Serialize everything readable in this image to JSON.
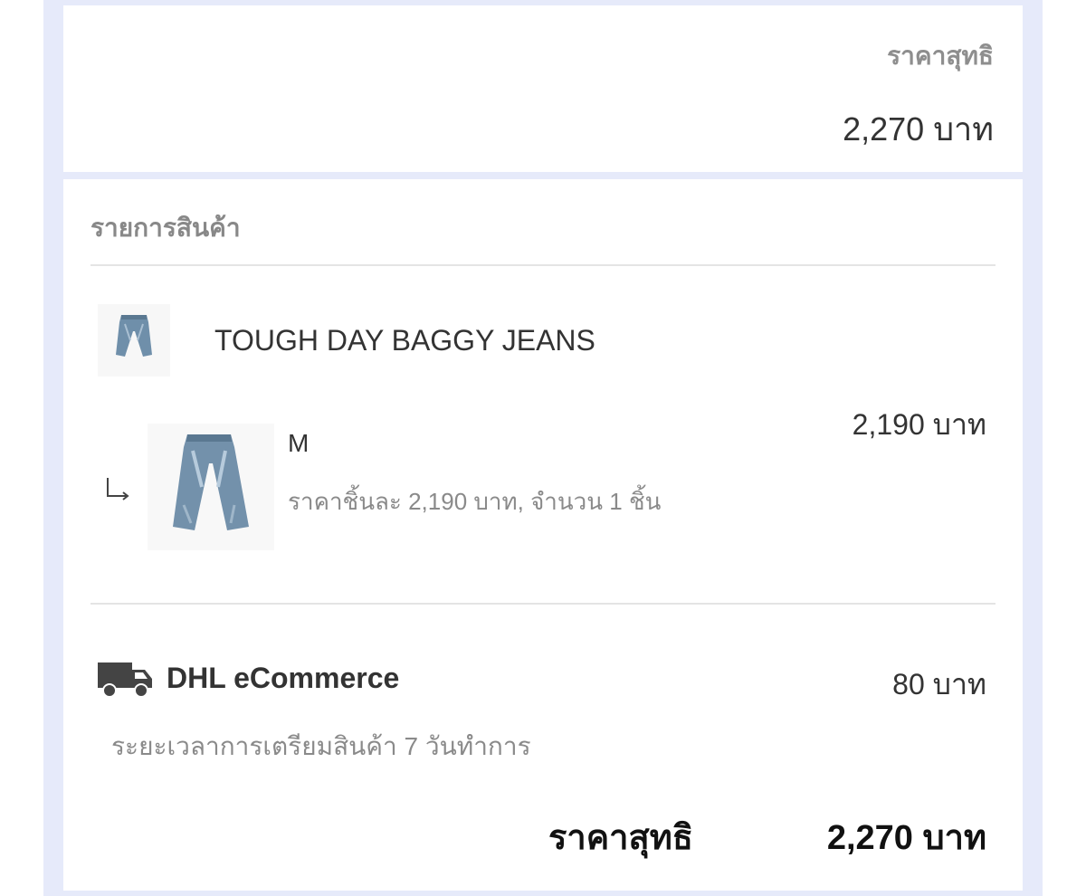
{
  "summary": {
    "label": "ราคาสุทธิ",
    "amount": "2,270 บาท"
  },
  "items_section": {
    "title": "รายการสินค้า",
    "product": {
      "name": "TOUGH DAY BAGGY JEANS",
      "thumbnail": "jeans-image"
    },
    "variant": {
      "name": "M",
      "description": "ราคาชิ้นละ 2,190 บาท, จำนวน 1 ชิ้น",
      "price": "2,190 บาท",
      "thumbnail": "jeans-image"
    }
  },
  "shipping": {
    "icon": "truck-icon",
    "carrier": "DHL eCommerce",
    "price": "80 บาท",
    "note": "ระยะเวลาการเตรียมสินค้า 7 วันทำการ"
  },
  "total": {
    "label": "ราคาสุทธิ",
    "amount": "2,270 บาท"
  },
  "colors": {
    "frame": "#e6eafa",
    "card": "#ffffff",
    "text_primary": "#333333",
    "text_secondary": "#8a8a8a",
    "denim": "#6f8faa"
  }
}
